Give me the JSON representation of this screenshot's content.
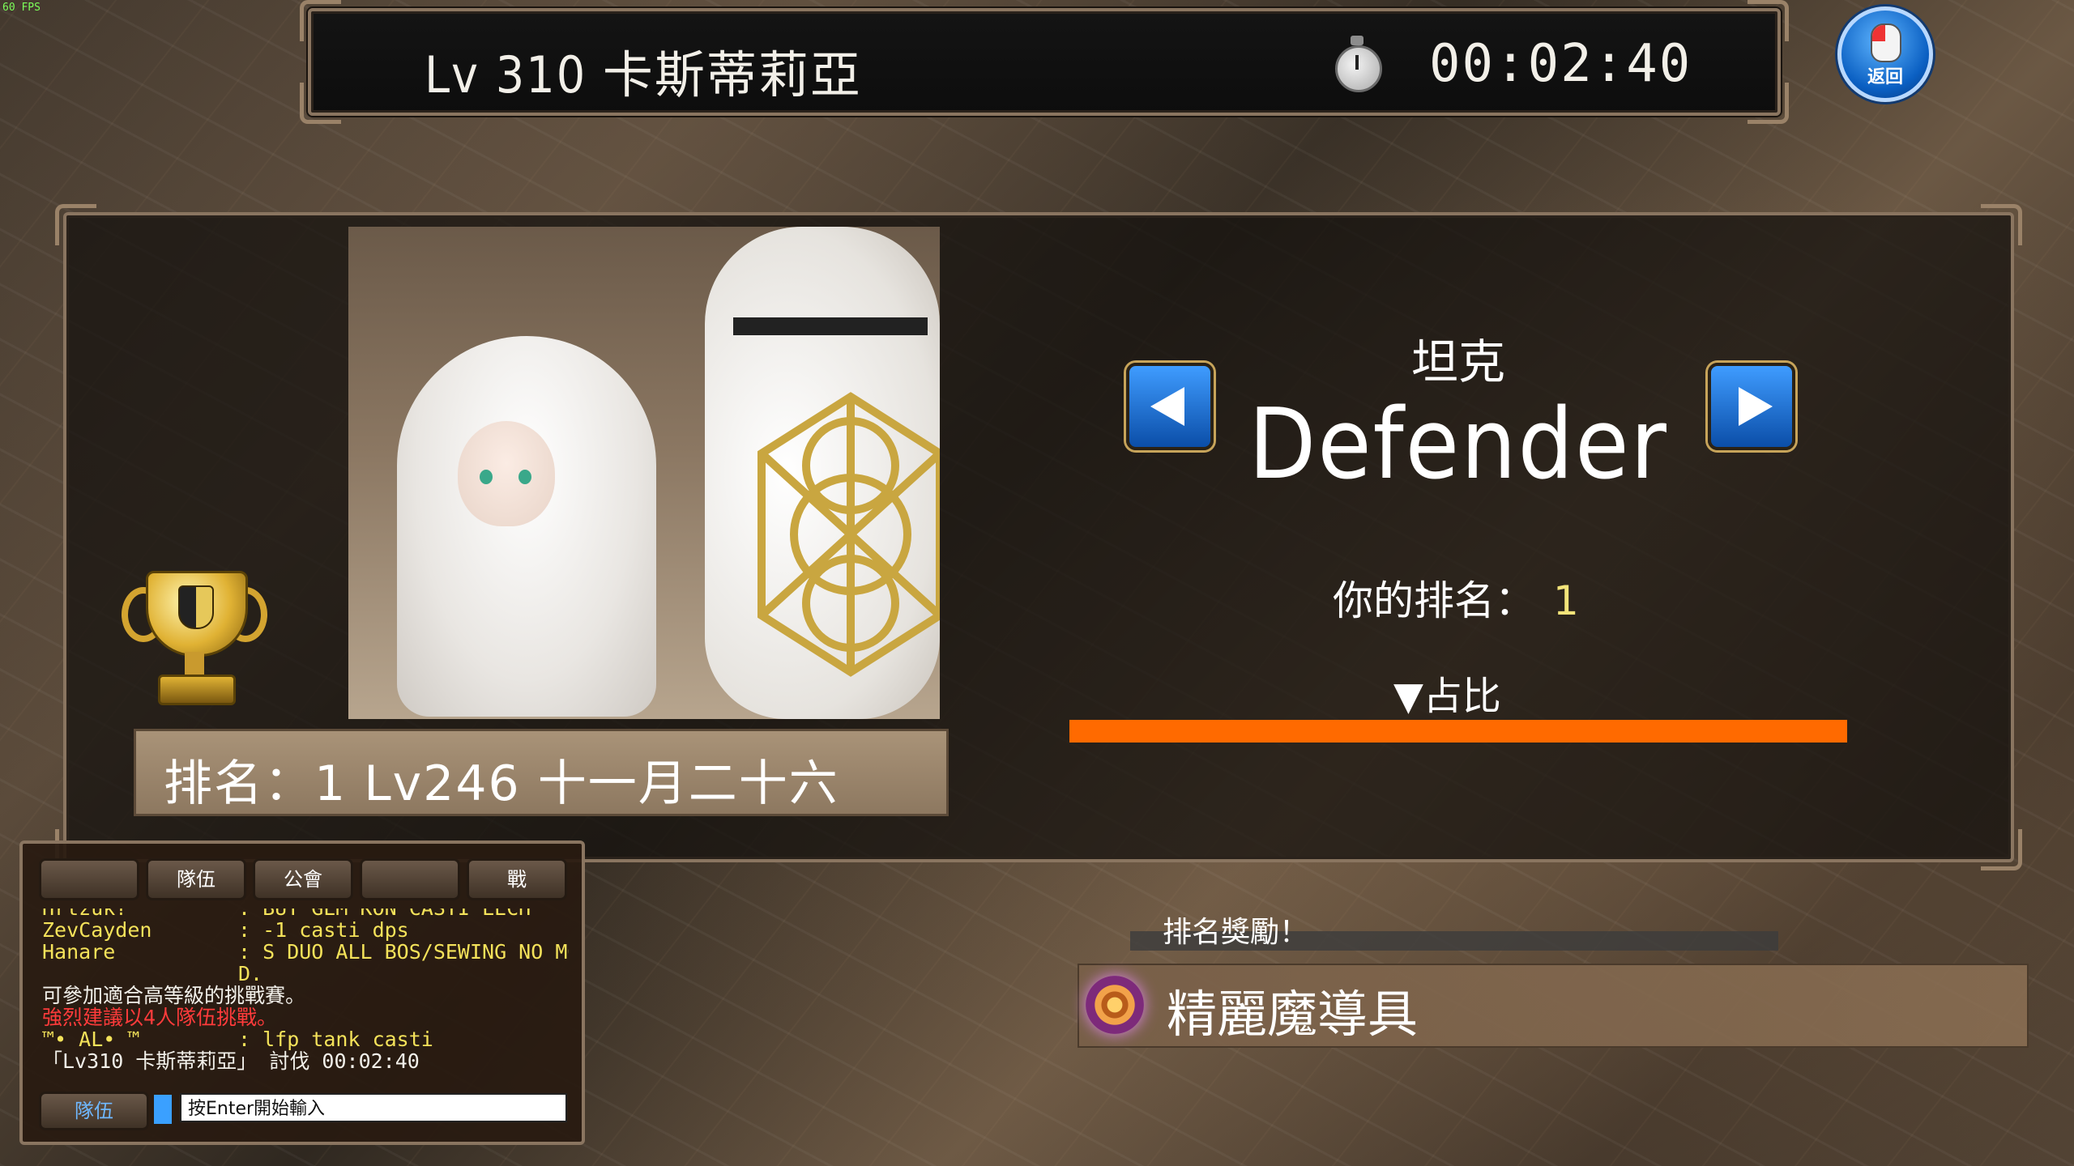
{
  "hud": {
    "fps": "60 FPS"
  },
  "header": {
    "boss_title": "Lv 310 卡斯蒂莉亞",
    "timer": "00:02:40",
    "stopwatch_icon": "stopwatch-icon"
  },
  "return_button": {
    "label": "返回",
    "icon": "mouse-icon"
  },
  "ranking": {
    "portrait_caption": "排名：1 Lv246  十一月二十六",
    "role_cn": "坦克",
    "role_en": "Defender",
    "your_rank_label": "你的排名：",
    "your_rank_value": "1",
    "share_label": "▼占比",
    "share_fraction": 1.0,
    "share_color": "#ff6a00",
    "prev_icon": "arrow-left-icon",
    "next_icon": "arrow-right-icon",
    "trophy_icon": "trophy-icon"
  },
  "chat": {
    "tabs": [
      "",
      "隊伍",
      "公會",
      "",
      "戰"
    ],
    "lines": [
      {
        "name": "Hrtzuk?",
        "text": ": BUY GEM KON CASTI LECH",
        "color": "yellow"
      },
      {
        "name": "ZevCayden",
        "text": ": -1 casti dps",
        "color": "yellow"
      },
      {
        "name": "Hanare",
        "text": ": S DUO ALL BOS/SEWING NO MO",
        "color": "yellow"
      },
      {
        "name": "",
        "text": "D.",
        "color": "yellow"
      },
      {
        "name": "可參加適合高等級的挑戰賽。",
        "text": "",
        "color": "white"
      },
      {
        "name": " 強烈建議以4人隊伍挑戰。",
        "text": "",
        "color": "red"
      },
      {
        "name": "™• AL• ™",
        "text": ": lfp tank casti",
        "color": "yellow"
      },
      {
        "name": "「Lv310 卡斯蒂莉亞」 討伐 00:02:40",
        "text": "",
        "color": "white"
      }
    ],
    "mode_button": "隊伍",
    "input_placeholder": "按Enter開始輸入"
  },
  "reward": {
    "header": "排名獎勵！",
    "item_name": "精麗魔導具",
    "item_icon": "ring-item-icon"
  }
}
